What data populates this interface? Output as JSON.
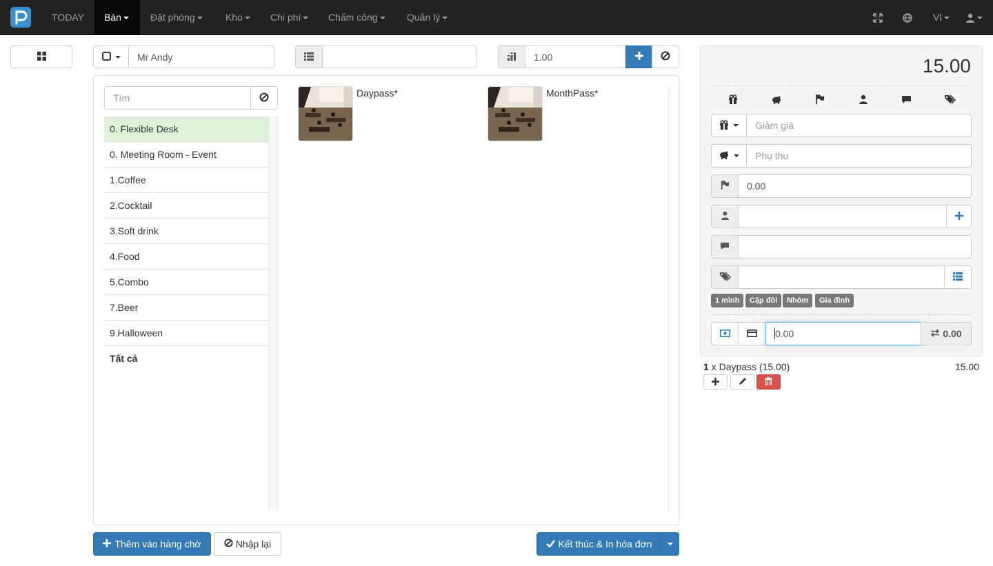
{
  "nav": {
    "today": "TODAY",
    "menus": [
      "Bán",
      "Đặt phòng",
      "Kho",
      "Chi phí",
      "Chấm công",
      "Quản lý"
    ],
    "language": "VI"
  },
  "toolbar": {
    "customer_name": "Mr Andy",
    "table_value": "",
    "quantity": "1.00"
  },
  "search": {
    "placeholder": "Tìm"
  },
  "categories": [
    "0. Flexible Desk",
    "0. Meeting Room - Event",
    "1.Coffee",
    "2.Cocktail",
    "3.Soft drink",
    "4.Food",
    "5.Combo",
    "7.Beer",
    "9.Halloween",
    "Tất cả"
  ],
  "products": [
    {
      "name": "Daypass*"
    },
    {
      "name": "MonthPass*"
    }
  ],
  "order": {
    "total": "15.00",
    "discount_placeholder": "Giảm giá",
    "surcharge_placeholder": "Phụ thu",
    "flag_value": "0.00",
    "tags": [
      "1 mình",
      "Cặp đôi",
      "Nhóm",
      "Gia đình"
    ],
    "payment_value": "0.00",
    "change_value": "0.00"
  },
  "line_items": [
    {
      "qty": "1",
      "desc": "x Daypass (15.00)",
      "amount": "15.00"
    }
  ],
  "actions": {
    "add_queue": "Thêm vào hàng chờ",
    "reset": "Nhập lại",
    "finish": "Kết thúc & In hóa đơn"
  },
  "colors": {
    "primary": "#337ab7",
    "danger": "#d9534f",
    "navbar": "#222222",
    "selected": "#dff0d8"
  }
}
